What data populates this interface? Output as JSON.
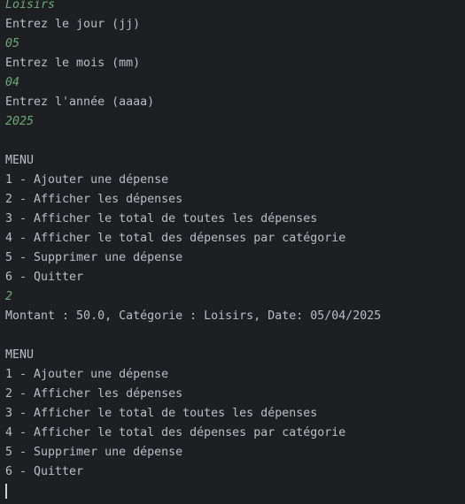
{
  "console": {
    "lines": [
      {
        "text": "Loisirs",
        "kind": "input"
      },
      {
        "text": "Entrez le jour (jj)",
        "kind": "output"
      },
      {
        "text": "05",
        "kind": "input"
      },
      {
        "text": "Entrez le mois (mm)",
        "kind": "output"
      },
      {
        "text": "04",
        "kind": "input"
      },
      {
        "text": "Entrez l'année (aaaa)",
        "kind": "output"
      },
      {
        "text": "2025",
        "kind": "input"
      },
      {
        "text": "",
        "kind": "blank"
      },
      {
        "text": "MENU",
        "kind": "output"
      },
      {
        "text": "1 - Ajouter une dépense",
        "kind": "output"
      },
      {
        "text": "2 - Afficher les dépenses",
        "kind": "output"
      },
      {
        "text": "3 - Afficher le total de toutes les dépenses",
        "kind": "output"
      },
      {
        "text": "4 - Afficher le total des dépenses par catégorie",
        "kind": "output"
      },
      {
        "text": "5 - Supprimer une dépense",
        "kind": "output"
      },
      {
        "text": "6 - Quitter",
        "kind": "output"
      },
      {
        "text": "2",
        "kind": "input"
      },
      {
        "text": "Montant : 50.0, Catégorie : Loisirs, Date: 05/04/2025",
        "kind": "output"
      },
      {
        "text": "",
        "kind": "blank"
      },
      {
        "text": "MENU",
        "kind": "output"
      },
      {
        "text": "1 - Ajouter une dépense",
        "kind": "output"
      },
      {
        "text": "2 - Afficher les dépenses",
        "kind": "output"
      },
      {
        "text": "3 - Afficher le total de toutes les dépenses",
        "kind": "output"
      },
      {
        "text": "4 - Afficher le total des dépenses par catégorie",
        "kind": "output"
      },
      {
        "text": "5 - Supprimer une dépense",
        "kind": "output"
      },
      {
        "text": "6 - Quitter",
        "kind": "output"
      }
    ]
  },
  "colors": {
    "background": "#1e1f22",
    "output_text": "#bcbec4",
    "input_text": "#6aab73"
  }
}
